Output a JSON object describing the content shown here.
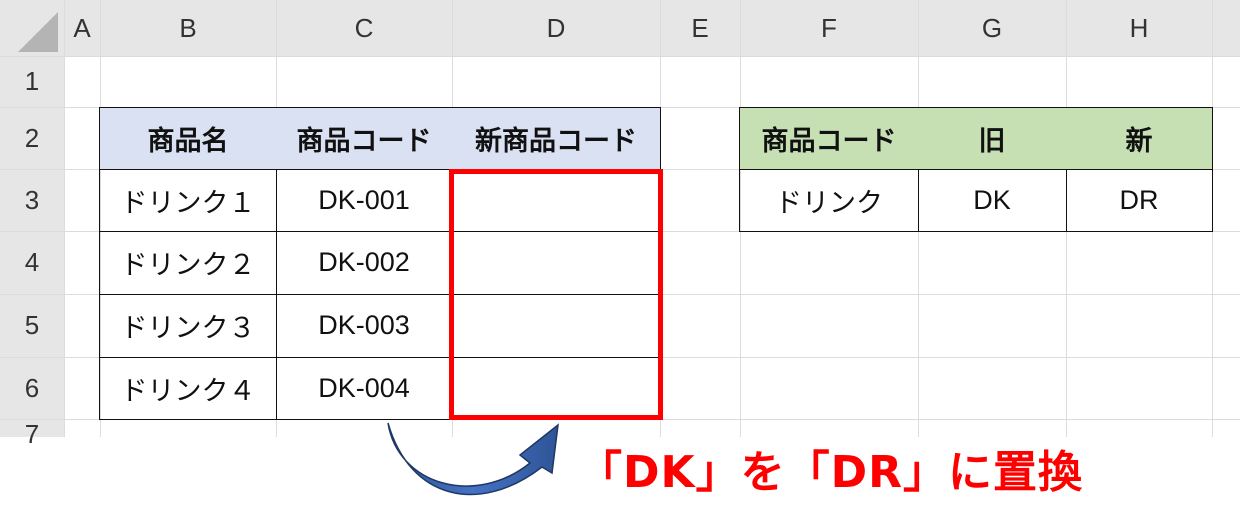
{
  "columns": [
    "A",
    "B",
    "C",
    "D",
    "E",
    "F",
    "G",
    "H"
  ],
  "rows": [
    "1",
    "2",
    "3",
    "4",
    "5",
    "6",
    "7"
  ],
  "table_left": {
    "headers": [
      "商品名",
      "商品コード",
      "新商品コード"
    ],
    "rows": [
      {
        "name": "ドリンク１",
        "code": "DK-001",
        "new_code": ""
      },
      {
        "name": "ドリンク２",
        "code": "DK-002",
        "new_code": ""
      },
      {
        "name": "ドリンク３",
        "code": "DK-003",
        "new_code": ""
      },
      {
        "name": "ドリンク４",
        "code": "DK-004",
        "new_code": ""
      }
    ]
  },
  "table_right": {
    "headers": [
      "商品コード",
      "旧",
      "新"
    ],
    "row": {
      "code": "ドリンク",
      "old": "DK",
      "new": "DR"
    }
  },
  "annotation": {
    "caption": "「DK」を「DR」に置換",
    "arrow_color": "#2f5597",
    "highlight_color": "#ff0000"
  }
}
